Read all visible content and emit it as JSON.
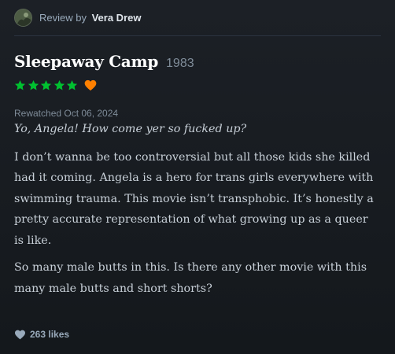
{
  "review": {
    "by_label": "Review by",
    "author": "Vera Drew",
    "film_title": "Sleepaway Camp",
    "film_year": "1983",
    "rating_stars": 5,
    "liked": true,
    "rewatched": "Rewatched Oct 06, 2024",
    "quote": "Yo, Angela! How come yer so fucked up?",
    "paragraphs": [
      "I don’t wanna be too controversial but all those kids she killed had it coming. Angela is a hero for trans girls everywhere with swimming trauma. This movie isn’t transphobic. It’s honestly a pretty accurate representation of what growing up as a queer is like.",
      "So many male butts in this. Is there any other movie with this many male butts and short shorts?"
    ],
    "likes": "263 likes"
  },
  "colors": {
    "star": "#00c030",
    "like_heart": "#ff8000",
    "likes_heart": "#9ab"
  },
  "icons": {
    "star": "star-icon",
    "like": "heart-icon",
    "likes": "heart-icon"
  }
}
